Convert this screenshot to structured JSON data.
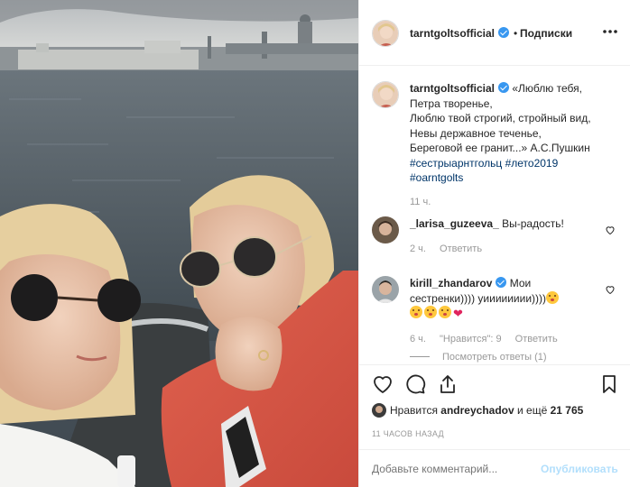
{
  "header": {
    "username": "tarntgoltsofficial",
    "separator": "•",
    "follow_label": "Подписки",
    "more_icon": "more-dots-icon"
  },
  "caption": {
    "username": "tarntgoltsofficial",
    "lines": [
      "«Люблю тебя,",
      "Петра творенье,",
      "Люблю твой строгий, стройный вид,",
      "Невы державное теченье,",
      "Береговой ее гранит...» А.С.Пушкин"
    ],
    "hashtags_line1": "#сестрыарнтгольц #лето2019",
    "hashtags_line2": "#oarntgolts",
    "time": "11 ч."
  },
  "comments": [
    {
      "username": "_larisa_guzeeva_",
      "text": "Вы-радость!",
      "time": "2 ч.",
      "reply_label": "Ответить"
    },
    {
      "username": "kirill_zhandarov",
      "text": "Мои сестренки)))) уииииииии))))",
      "time": "6 ч.",
      "likes_label": "\"Нравится\": 9",
      "reply_label": "Ответить",
      "view_replies": "Посмотреть ответы (1)"
    }
  ],
  "actions": {
    "like_icon": "heart-icon",
    "comment_icon": "comment-icon",
    "share_icon": "share-icon",
    "save_icon": "bookmark-icon"
  },
  "likes": {
    "prefix": "Нравится",
    "user": "andreychadov",
    "suffix": "и ещё",
    "count": "21 765"
  },
  "timestamp": "11 ЧАСОВ НАЗАД",
  "add_comment": {
    "placeholder": "Добавьте комментарий...",
    "publish_label": "Опубликовать"
  },
  "colors": {
    "link": "#003569",
    "verified": "#3897f0",
    "publish_disabled": "#b2dffc",
    "muted": "#999999"
  }
}
